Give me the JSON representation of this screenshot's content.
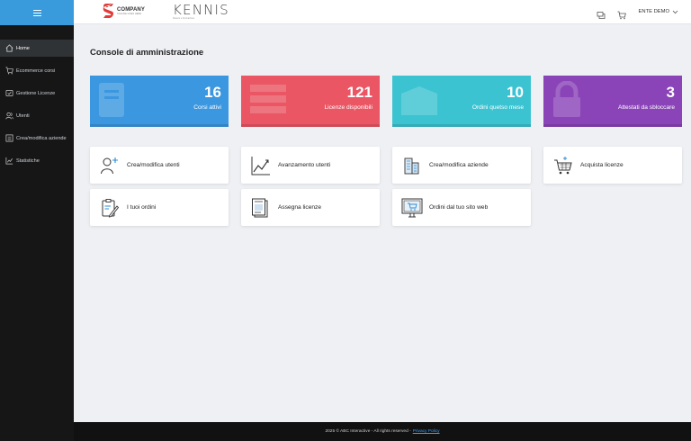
{
  "sidebar": {
    "items": [
      {
        "label": "Home",
        "icon": "home-icon"
      },
      {
        "label": "Ecommerce corsi",
        "icon": "cart-icon"
      },
      {
        "label": "Gestione Licenze",
        "icon": "license-icon"
      },
      {
        "label": "Utenti",
        "icon": "users-icon"
      },
      {
        "label": "Crea/modifica aziende",
        "icon": "building-icon"
      },
      {
        "label": "Statistiche",
        "icon": "chart-icon"
      }
    ],
    "active_index": 0,
    "accent": "#3a9bdc"
  },
  "header": {
    "brand1": "COMPANY",
    "brand1_sub": "TAGLINE GOES HERE",
    "brand2": "KENNIS",
    "brand2_sub": "Sistemi e Formazione",
    "user_label": "ENTE DEMO"
  },
  "main": {
    "title": "Console di amministrazione",
    "stats": [
      {
        "value": "16",
        "label": "Corsi attivi",
        "color": "#3b97df"
      },
      {
        "value": "121",
        "label": "Licenze disponibili",
        "color": "#ea5664"
      },
      {
        "value": "10",
        "label": "Ordini quetso mese",
        "color": "#3cc3d1"
      },
      {
        "value": "3",
        "label": "Attestati da sbloccare",
        "color": "#8a44b8"
      }
    ],
    "actions": [
      {
        "label": "Crea/modifica utenti",
        "icon": "add-user-icon"
      },
      {
        "label": "Avanzamento utenti",
        "icon": "line-chart-icon"
      },
      {
        "label": "Crea/modifica aziende",
        "icon": "buildings-icon"
      },
      {
        "label": "Acquista licenze",
        "icon": "shopping-cart-icon"
      },
      {
        "label": "I tuoi ordini",
        "icon": "clipboard-icon"
      },
      {
        "label": "Assegna licenze",
        "icon": "document-icon"
      },
      {
        "label": "Ordini dal tuo sito web",
        "icon": "web-cart-icon"
      }
    ]
  },
  "footer": {
    "text": "2025 © ABC Interactive - All rights reserved -",
    "link": "Privacy Policy"
  }
}
